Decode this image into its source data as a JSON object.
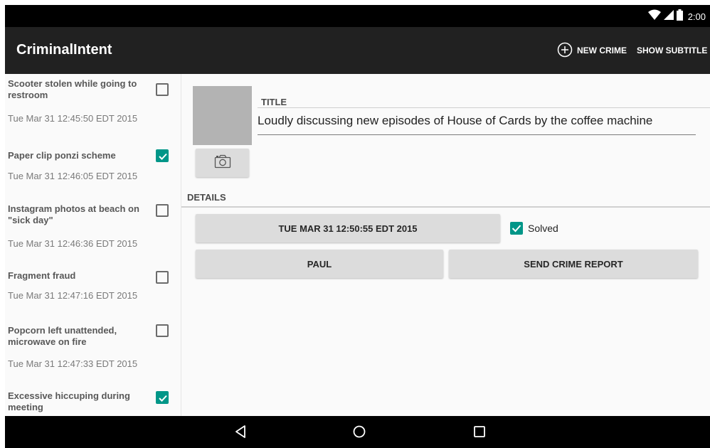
{
  "status_bar": {
    "time": "2:00"
  },
  "app_bar": {
    "title": "CriminalIntent",
    "new_crime_label": "NEW CRIME",
    "show_subtitle_label": "SHOW SUBTITLE"
  },
  "crimes": [
    {
      "title": "Scooter stolen while going to restroom",
      "date": "Tue Mar 31 12:45:50 EDT 2015",
      "solved": false
    },
    {
      "title": "Paper clip ponzi scheme",
      "date": "Tue Mar 31 12:46:05 EDT 2015",
      "solved": true
    },
    {
      "title": "Instagram photos at beach on \"sick day\"",
      "date": "Tue Mar 31 12:46:36 EDT 2015",
      "solved": false
    },
    {
      "title": "Fragment fraud",
      "date": "Tue Mar 31 12:47:16 EDT 2015",
      "solved": false
    },
    {
      "title": "Popcorn left unattended, microwave on fire",
      "date": "Tue Mar 31 12:47:33 EDT 2015",
      "solved": false
    },
    {
      "title": "Excessive hiccuping during meeting",
      "date": "",
      "solved": true
    }
  ],
  "detail": {
    "title_label": "TITLE",
    "title_value": "Loudly discussing new episodes of House of Cards by the coffee machine",
    "details_label": "DETAILS",
    "date_button": "TUE MAR 31 12:50:55 EDT 2015",
    "solved_label": "Solved",
    "solved": true,
    "suspect_button": "PAUL",
    "report_button": "SEND CRIME REPORT"
  },
  "colors": {
    "accent": "#009688",
    "app_bar": "#212121",
    "status_bar": "#000000"
  },
  "icons": [
    "wifi-icon",
    "cell-signal-icon",
    "battery-icon",
    "add-circle-icon",
    "camera-icon",
    "back-icon",
    "home-icon",
    "recents-icon",
    "checkmark-icon"
  ]
}
